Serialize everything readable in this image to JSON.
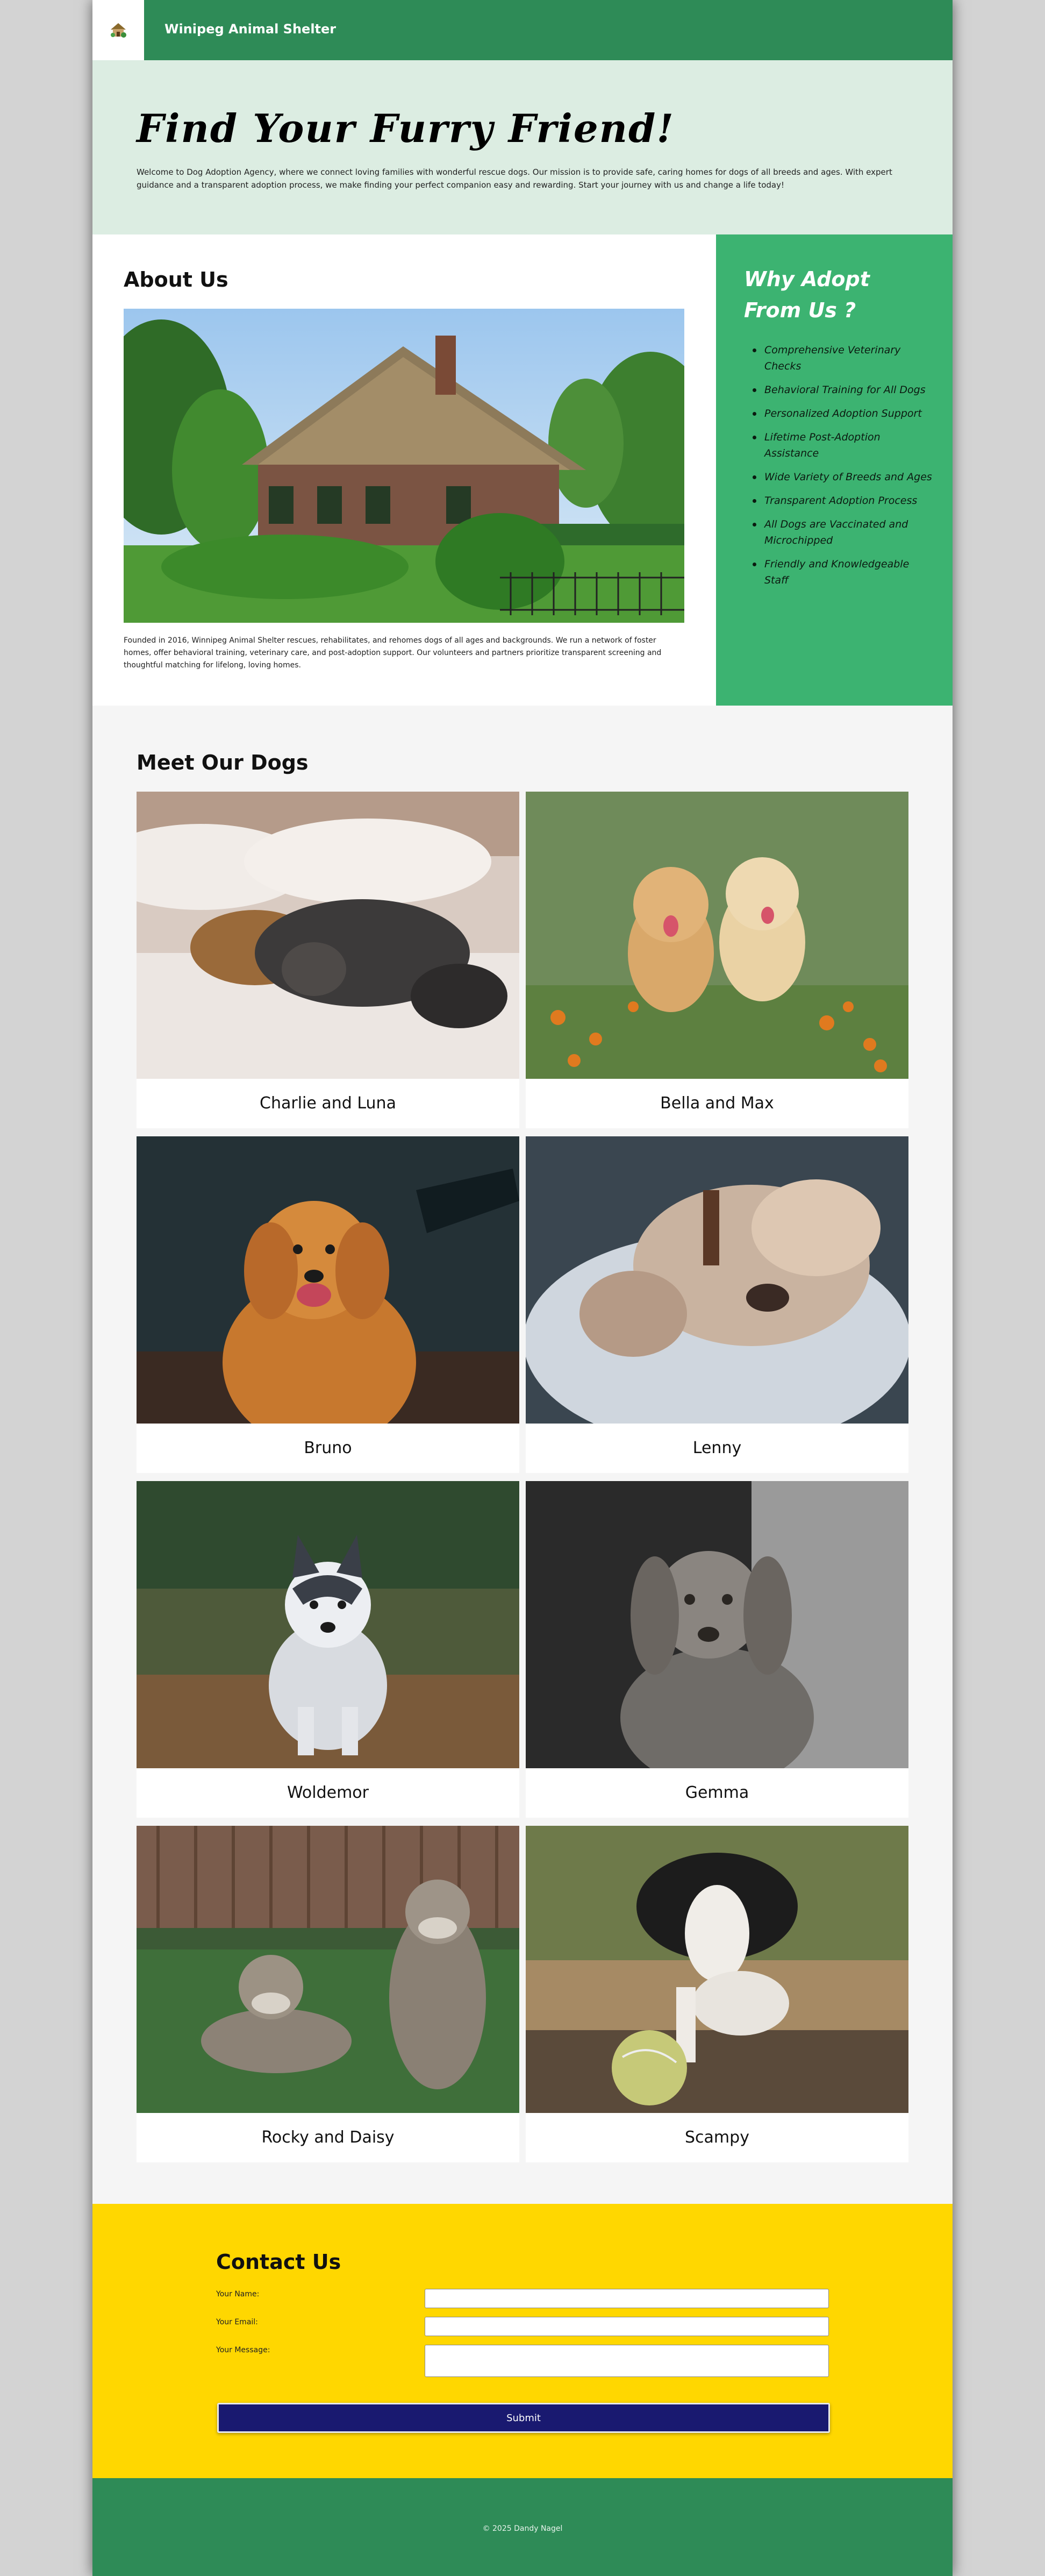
{
  "header": {
    "brand": "Winipeg Animal Shelter",
    "logo_icon": "house-icon"
  },
  "hero": {
    "title": "Find Your Furry Friend!",
    "intro": "Welcome to Dog Adoption Agency, where we connect loving families with wonderful rescue dogs. Our mission is to provide safe, caring homes for dogs of all breeds and ages. With expert guidance and a transparent adoption process, we make finding your perfect companion easy and rewarding. Start your journey with us and change a life today!"
  },
  "about": {
    "title": "About Us",
    "image_icon": "thatched-cottage-photo",
    "text": "Founded in 2016, Winnipeg Animal Shelter rescues, rehabilitates, and rehomes dogs of all ages and backgrounds. We run a network of foster homes, offer behavioral training, veterinary care, and post-adoption support. Our volunteers and partners prioritize transparent screening and thoughtful matching for lifelong, loving homes."
  },
  "why": {
    "title": "Why Adopt From Us ?",
    "items": [
      "Comprehensive Veterinary Checks",
      "Behavioral Training for All Dogs",
      "Personalized Adoption Support",
      "Lifetime Post-Adoption Assistance",
      "Wide Variety of Breeds and Ages",
      "Transparent Adoption Process",
      "All Dogs are Vaccinated and Microchipped",
      "Friendly and Knowledgeable Staff"
    ]
  },
  "dogs": {
    "title": "Meet Our Dogs",
    "cards": [
      {
        "name": "Charlie and Luna"
      },
      {
        "name": "Bella and Max"
      },
      {
        "name": "Bruno"
      },
      {
        "name": "Lenny"
      },
      {
        "name": "Woldemor"
      },
      {
        "name": "Gemma"
      },
      {
        "name": "Rocky and Daisy"
      },
      {
        "name": "Scampy"
      }
    ]
  },
  "contact": {
    "title": "Contact Us",
    "name_label": "Your Name:",
    "email_label": "Your Email:",
    "message_label": "Your Message:",
    "name_value": "",
    "email_value": "",
    "message_value": "",
    "submit_label": "Submit"
  },
  "footer": {
    "copyright": "© 2025 Dandy Nagel"
  },
  "colors": {
    "header_green": "#2e8b57",
    "hero_bg": "#dcede2",
    "why_green": "#3cb371",
    "contact_yellow": "#ffd700",
    "submit_navy": "#191970"
  }
}
